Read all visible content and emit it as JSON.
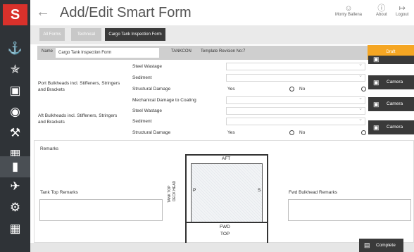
{
  "app": {
    "logo": "S",
    "title": "Add/Edit Smart Form"
  },
  "header": {
    "user": "Monty Ballena",
    "about": "About",
    "logout": "Logout"
  },
  "rail": [
    {
      "icon": "ship-icon"
    },
    {
      "icon": "crane-icon"
    },
    {
      "icon": "inbox-icon"
    },
    {
      "icon": "gauge-icon"
    },
    {
      "icon": "tools-icon"
    },
    {
      "icon": "image-icon"
    },
    {
      "icon": "document-icon"
    },
    {
      "icon": "plane-icon"
    },
    {
      "icon": "gear-icon"
    },
    {
      "icon": "chart-icon"
    }
  ],
  "tabs": [
    {
      "label": "All Forms"
    },
    {
      "label": "Technical"
    },
    {
      "label": "Cargo Tank Inspection Form"
    }
  ],
  "name_row": {
    "label": "Name",
    "value": "Cargo Tank Inspection Form",
    "code": "TANKCON",
    "revision": "Template Revision No:7",
    "status": "Draft"
  },
  "sections": [
    {
      "label": "Port Bulkheads incl. Stiffeners, Stringers and Brackets",
      "rows": [
        "Steel Wastage",
        "Sediment",
        "Structural Damage",
        "Mechanical Damage to Coating"
      ]
    },
    {
      "label": "Aft Bulkheads incl. Stiffeners, Stringers and Brackets",
      "rows": [
        "Steel Wastage",
        "Sediment",
        "Structural Damage"
      ]
    }
  ],
  "answers": {
    "yes": "Yes",
    "no": "No"
  },
  "camera": {
    "label": "Camera"
  },
  "remarks": {
    "title": "Remarks",
    "tank_top": "Tank Top Remarks",
    "fwd_bulkhead": "Fwd Bulkhead Remarks"
  },
  "diagram": {
    "aft": "AFT",
    "fwd": "FWD",
    "top": "TOP",
    "p": "P",
    "s": "S",
    "tank_top": "TANK TOP",
    "deck_head": "DECK HEAD"
  },
  "footer": {
    "complete": "Complete"
  }
}
